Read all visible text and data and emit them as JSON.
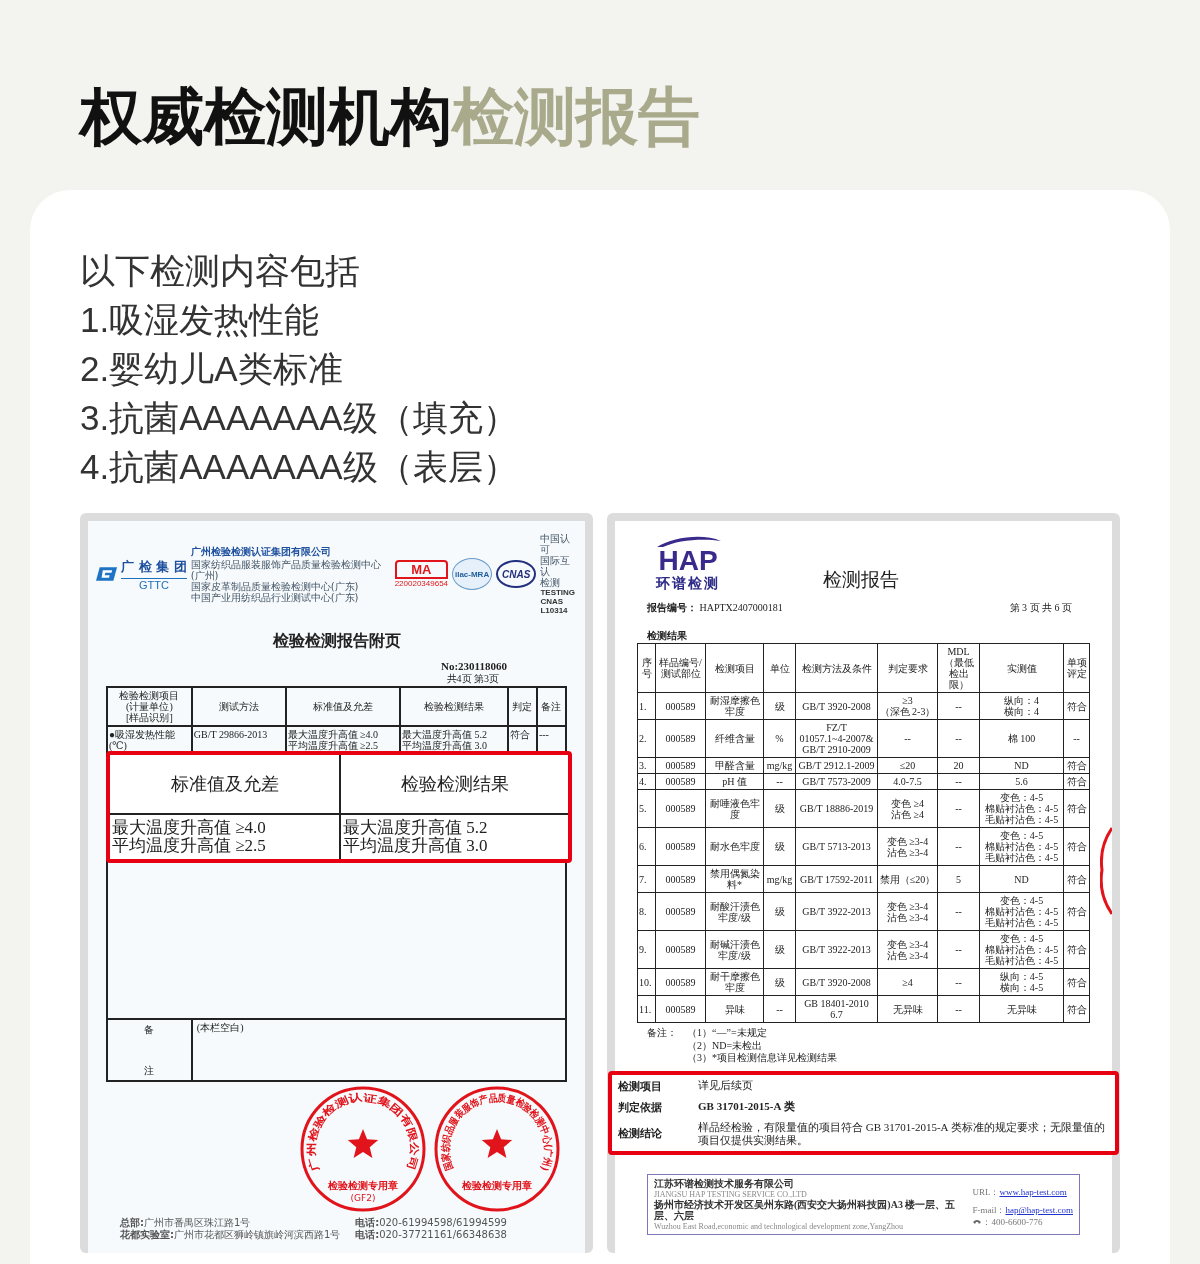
{
  "heading": {
    "dark": "权威检测机构",
    "accent": "检测报告"
  },
  "intro": {
    "lead": "以下检测内容包括",
    "items": [
      "1.吸湿发热性能",
      "2.婴幼儿A类标准",
      "3.抗菌AAAAAAA级（填充）",
      "4.抗菌AAAAAAA级（表层）"
    ]
  },
  "gttc_report": {
    "logo": {
      "name": "广 检 集 团",
      "code": "GTTC"
    },
    "company": {
      "name": "广州检验检测认证集团有限公司",
      "lines": [
        "国家纺织品服装服饰产品质量检验检测中心(广州)",
        "国家皮革制品质量检验检测中心(广东)",
        "中国产业用纺织品行业测试中心(广东)"
      ]
    },
    "marks": {
      "ma": "MA",
      "ma_number": "220020349654",
      "ilac": "ilac-MRA",
      "cnas": "CNAS",
      "cnas_lines": [
        "中国认可",
        "国际互认",
        "检测"
      ],
      "cnas_codes": [
        "TESTING",
        "CNAS L10314"
      ]
    },
    "title": "检验检测报告附页",
    "number": "No:230118060",
    "pages": "共4页 第3页",
    "columns": [
      "检验检测项目\n(计量单位)\n[样品识别]",
      "测试方法",
      "标准值及允差",
      "检验检测结果",
      "判定",
      "备注"
    ],
    "rows": [
      {
        "cells": [
          "●吸湿发热性能\n(℃)",
          "GB/T 29866-2013",
          "最大温度升高值 ≥4.0\n平均温度升高值 ≥2.5",
          "最大温度升高值 5.2\n平均温度升高值 3.0",
          "符合",
          "---"
        ]
      }
    ],
    "remarks": {
      "label_chars": [
        "备",
        "注"
      ],
      "text": "(本栏空白)"
    },
    "callout": {
      "columns": [
        "标准值及允差",
        "检验检测结果"
      ],
      "cells": [
        "最大温度升高值 ≥4.0\n平均温度升高值 ≥2.5",
        "最大温度升高值 5.2\n平均温度升高值 3.0"
      ]
    },
    "seals": [
      {
        "ring": "广州检验检测认证集团有限公司",
        "center": "检验检测专用章",
        "code": "(GF2)"
      },
      {
        "ring": "国家纺织品服装服饰产品质量检验检测中心(广州)",
        "center": "检验检测专用章"
      }
    ],
    "footer": {
      "left": [
        "**总部:**广州市番禺区珠江路1号",
        "**花都实验室:**广州市花都区狮岭镇旗岭河滨西路1号"
      ],
      "right": [
        "**电话:**020-61994598/61994599",
        "**电话:**020-37721161/66348638"
      ]
    }
  },
  "hap_report": {
    "logo": {
      "code": "HAP",
      "name": "环谱检测"
    },
    "title": "检测报告",
    "number_label": "报告编号：",
    "number": "HAPTX2407000181",
    "pages": "第 3 页 共 6 页",
    "section": "检测结果",
    "columns": [
      "序号",
      "样品编号/\n测试部位",
      "检测项目",
      "单位",
      "检测方法及条件",
      "判定要求",
      "MDL\n（最低检出限）",
      "实测值",
      "单项评定"
    ],
    "rows": [
      {
        "cells": [
          "1.",
          "000589",
          "耐湿摩擦色牢度",
          "级",
          "GB/T 3920-2008",
          "≥3\n（深色 2-3）",
          "--",
          "纵向：4\n横向：4",
          "符合"
        ]
      },
      {
        "cells": [
          "2.",
          "000589",
          "纤维含量",
          "%",
          "FZ/T\n01057.1~4-2007&\nGB/T 2910-2009",
          "--",
          "--",
          "棉 100",
          "--"
        ]
      },
      {
        "cells": [
          "3.",
          "000589",
          "甲醛含量",
          "mg/kg",
          "GB/T 2912.1-2009",
          "≤20",
          "20",
          "ND",
          "符合"
        ]
      },
      {
        "cells": [
          "4.",
          "000589",
          "pH 值",
          "--",
          "GB/T 7573-2009",
          "4.0-7.5",
          "--",
          "5.6",
          "符合"
        ]
      },
      {
        "cells": [
          "5.",
          "000589",
          "耐唾液色牢度",
          "级",
          "GB/T 18886-2019",
          "变色 ≥4\n沾色 ≥4",
          "--",
          "变色：4-5\n棉贴衬沾色：4-5\n毛贴衬沾色：4-5",
          "符合"
        ]
      },
      {
        "cells": [
          "6.",
          "000589",
          "耐水色牢度",
          "级",
          "GB/T 5713-2013",
          "变色 ≥3-4\n沾色 ≥3-4",
          "--",
          "变色：4-5\n棉贴衬沾色：4-5\n毛贴衬沾色：4-5",
          "符合"
        ]
      },
      {
        "cells": [
          "7.",
          "000589",
          "禁用偶氮染料*",
          "mg/kg",
          "GB/T 17592-2011",
          "禁用（≤20）",
          "5",
          "ND",
          "符合"
        ]
      },
      {
        "cells": [
          "8.",
          "000589",
          "耐酸汗渍色牢度/级",
          "级",
          "GB/T 3922-2013",
          "变色 ≥3-4\n沾色 ≥3-4",
          "--",
          "变色：4-5\n棉贴衬沾色：4-5\n毛贴衬沾色：4-5",
          "符合"
        ]
      },
      {
        "cells": [
          "9.",
          "000589",
          "耐碱汗渍色牢度/级",
          "级",
          "GB/T 3922-2013",
          "变色 ≥3-4\n沾色 ≥3-4",
          "--",
          "变色：4-5\n棉贴衬沾色：4-5\n毛贴衬沾色：4-5",
          "符合"
        ]
      },
      {
        "cells": [
          "10.",
          "000589",
          "耐干摩擦色牢度",
          "级",
          "GB/T 3920-2008",
          "≥4",
          "--",
          "纵向：4-5\n横向：4-5",
          "符合"
        ]
      },
      {
        "cells": [
          "11.",
          "000589",
          "异味",
          "--",
          "GB 18401-2010\n6.7",
          "无异味",
          "--",
          "无异味",
          "符合"
        ]
      }
    ],
    "notes": {
      "label": "备注：",
      "items": [
        "（1）“—”=未规定",
        "（2）ND=未检出",
        "（3）*项目检测信息详见检测结果"
      ]
    },
    "conclusion": [
      {
        "label": "检测项目",
        "value": "详见后续页"
      },
      {
        "label": "判定依据",
        "value": "GB 31701-2015-A 类"
      },
      {
        "label": "检测结论",
        "value": "样品经检验，有限量值的项目符合 GB 31701-2015-A 类标准的规定要求；无限量值的项目仅提供实测结果。"
      }
    ],
    "footer": {
      "company": "江苏环谱检测技术服务有限公司",
      "company_en": "JIANGSU HAP TESTING SERVICE CO.,LTD",
      "address": "扬州市经济技术开发区吴州东路(西安交大扬州科技园)A3 楼一层、五层、六层",
      "address_en": "Wuzhou East Road,economic and technological development zone,YangZhou",
      "url_label": "URL：",
      "url": "www.hap-test.com",
      "email_label": "F-mail：",
      "email": "hap@hap-test.com",
      "phone": "：400-6600-776"
    }
  }
}
